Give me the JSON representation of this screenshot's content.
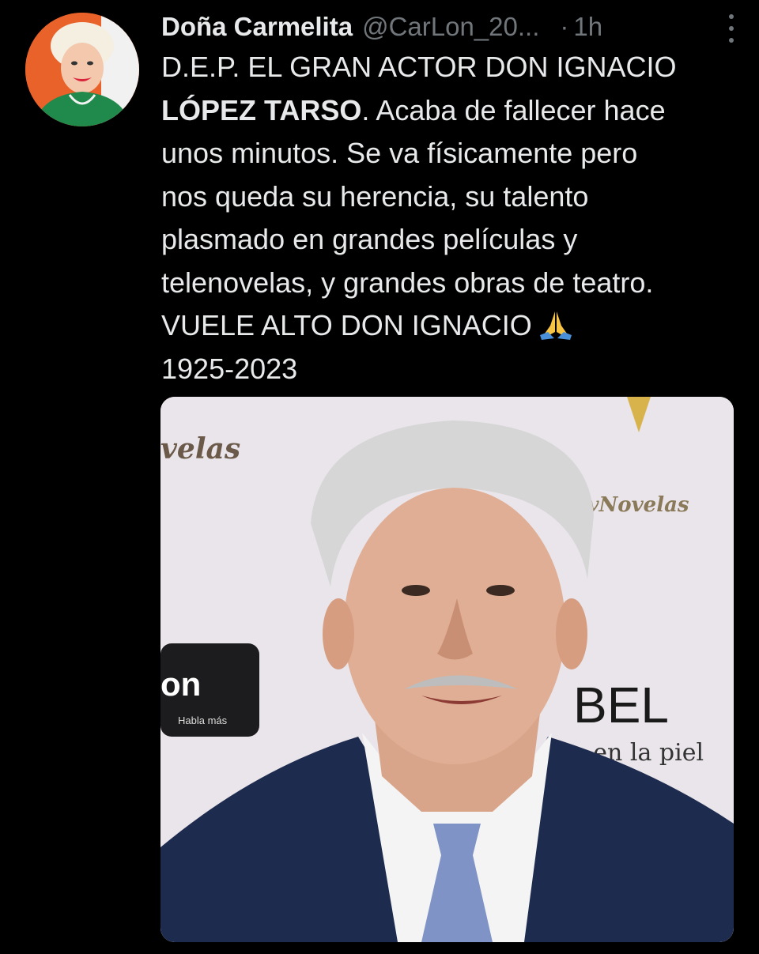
{
  "author": {
    "display_name": "Doña Carmelita",
    "handle": "@CarLon_20...",
    "separator": "·",
    "time": "1h",
    "avatar_icon": "profile-avatar"
  },
  "tweet": {
    "lines": [
      "D.E.P. EL GRAN ACTOR DON IGNACIO",
      "LÓPEZ TARSO",
      ". Acaba de fallecer hace",
      "unos minutos. Se va físicamente pero",
      "nos queda su herencia, su talento",
      "plasmado en grandes películas y",
      "telenovelas,  y grandes obras de teatro.",
      "VUELE ALTO DON IGNACIO",
      "1925-2023"
    ],
    "emoji_icon": "folded-hands-emoji"
  },
  "media": {
    "backdrop_texts": {
      "top_left": "velas",
      "top_right": "TvNovelas",
      "sponsor_main": "on",
      "sponsor_sub": "Habla más",
      "brand": "BEL",
      "brand_tag": "veo en la piel"
    }
  },
  "colors": {
    "background": "#000000",
    "text": "#e7e9ea",
    "muted": "#71767b",
    "avatar_bg": "#e8622a"
  }
}
